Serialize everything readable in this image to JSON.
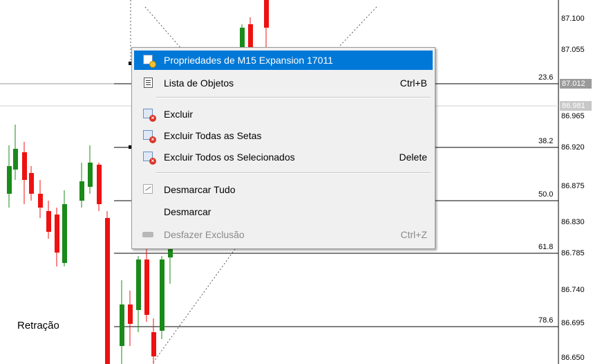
{
  "chart": {
    "label_retracao": "Retração",
    "price_levels": [
      "87.100",
      "87.055",
      "87.012",
      "86.981",
      "86.965",
      "86.920",
      "86.875",
      "86.830",
      "86.785",
      "86.740",
      "86.695",
      "86.650"
    ],
    "fib_levels": [
      "23.6",
      "38.2",
      "50.0",
      "61.8",
      "78.6"
    ],
    "colors": {
      "bull": "#1a8a1a",
      "bear": "#ee1111",
      "axis_hl_ask": "#9a9a9a",
      "axis_hl_bid": "#c8c8c8"
    }
  },
  "context_menu": {
    "items": [
      {
        "label": "Propriedades de M15 Expansion 17011",
        "shortcut": "",
        "icon": "properties-icon",
        "selected": true,
        "disabled": false
      },
      {
        "label": "Lista de Objetos",
        "shortcut": "Ctrl+B",
        "icon": "object-list-icon",
        "selected": false,
        "disabled": false
      },
      {
        "label": "Excluir",
        "shortcut": "",
        "icon": "delete-icon",
        "selected": false,
        "disabled": false
      },
      {
        "label": "Excluir Todas as Setas",
        "shortcut": "",
        "icon": "delete-arrows-icon",
        "selected": false,
        "disabled": false
      },
      {
        "label": "Excluir Todos os Selecionados",
        "shortcut": "Delete",
        "icon": "delete-selected-icon",
        "selected": false,
        "disabled": false
      },
      {
        "label": "Desmarcar Tudo",
        "shortcut": "",
        "icon": "unselect-all-icon",
        "selected": false,
        "disabled": false
      },
      {
        "label": "Desmarcar",
        "shortcut": "",
        "icon": "",
        "selected": false,
        "disabled": false
      },
      {
        "label": "Desfazer Exclusão",
        "shortcut": "Ctrl+Z",
        "icon": "undo-icon",
        "selected": false,
        "disabled": true
      }
    ]
  }
}
